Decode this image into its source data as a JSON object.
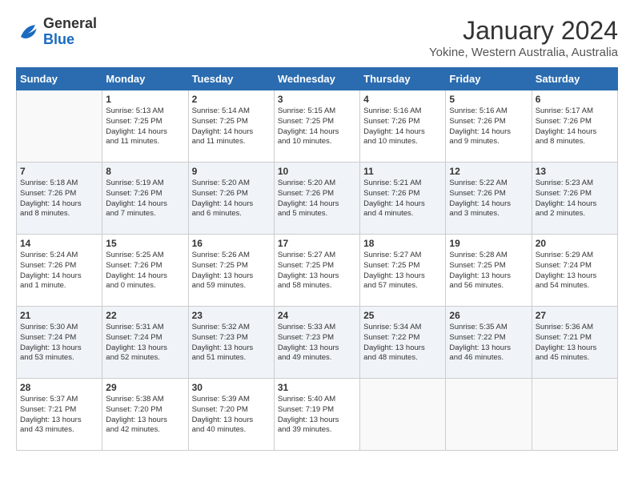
{
  "logo": {
    "general": "General",
    "blue": "Blue"
  },
  "title": "January 2024",
  "subtitle": "Yokine, Western Australia, Australia",
  "headers": [
    "Sunday",
    "Monday",
    "Tuesday",
    "Wednesday",
    "Thursday",
    "Friday",
    "Saturday"
  ],
  "weeks": [
    [
      {
        "date": "",
        "info": ""
      },
      {
        "date": "1",
        "info": "Sunrise: 5:13 AM\nSunset: 7:25 PM\nDaylight: 14 hours\nand 11 minutes."
      },
      {
        "date": "2",
        "info": "Sunrise: 5:14 AM\nSunset: 7:25 PM\nDaylight: 14 hours\nand 11 minutes."
      },
      {
        "date": "3",
        "info": "Sunrise: 5:15 AM\nSunset: 7:25 PM\nDaylight: 14 hours\nand 10 minutes."
      },
      {
        "date": "4",
        "info": "Sunrise: 5:16 AM\nSunset: 7:26 PM\nDaylight: 14 hours\nand 10 minutes."
      },
      {
        "date": "5",
        "info": "Sunrise: 5:16 AM\nSunset: 7:26 PM\nDaylight: 14 hours\nand 9 minutes."
      },
      {
        "date": "6",
        "info": "Sunrise: 5:17 AM\nSunset: 7:26 PM\nDaylight: 14 hours\nand 8 minutes."
      }
    ],
    [
      {
        "date": "7",
        "info": "Sunrise: 5:18 AM\nSunset: 7:26 PM\nDaylight: 14 hours\nand 8 minutes."
      },
      {
        "date": "8",
        "info": "Sunrise: 5:19 AM\nSunset: 7:26 PM\nDaylight: 14 hours\nand 7 minutes."
      },
      {
        "date": "9",
        "info": "Sunrise: 5:20 AM\nSunset: 7:26 PM\nDaylight: 14 hours\nand 6 minutes."
      },
      {
        "date": "10",
        "info": "Sunrise: 5:20 AM\nSunset: 7:26 PM\nDaylight: 14 hours\nand 5 minutes."
      },
      {
        "date": "11",
        "info": "Sunrise: 5:21 AM\nSunset: 7:26 PM\nDaylight: 14 hours\nand 4 minutes."
      },
      {
        "date": "12",
        "info": "Sunrise: 5:22 AM\nSunset: 7:26 PM\nDaylight: 14 hours\nand 3 minutes."
      },
      {
        "date": "13",
        "info": "Sunrise: 5:23 AM\nSunset: 7:26 PM\nDaylight: 14 hours\nand 2 minutes."
      }
    ],
    [
      {
        "date": "14",
        "info": "Sunrise: 5:24 AM\nSunset: 7:26 PM\nDaylight: 14 hours\nand 1 minute."
      },
      {
        "date": "15",
        "info": "Sunrise: 5:25 AM\nSunset: 7:26 PM\nDaylight: 14 hours\nand 0 minutes."
      },
      {
        "date": "16",
        "info": "Sunrise: 5:26 AM\nSunset: 7:25 PM\nDaylight: 13 hours\nand 59 minutes."
      },
      {
        "date": "17",
        "info": "Sunrise: 5:27 AM\nSunset: 7:25 PM\nDaylight: 13 hours\nand 58 minutes."
      },
      {
        "date": "18",
        "info": "Sunrise: 5:27 AM\nSunset: 7:25 PM\nDaylight: 13 hours\nand 57 minutes."
      },
      {
        "date": "19",
        "info": "Sunrise: 5:28 AM\nSunset: 7:25 PM\nDaylight: 13 hours\nand 56 minutes."
      },
      {
        "date": "20",
        "info": "Sunrise: 5:29 AM\nSunset: 7:24 PM\nDaylight: 13 hours\nand 54 minutes."
      }
    ],
    [
      {
        "date": "21",
        "info": "Sunrise: 5:30 AM\nSunset: 7:24 PM\nDaylight: 13 hours\nand 53 minutes."
      },
      {
        "date": "22",
        "info": "Sunrise: 5:31 AM\nSunset: 7:24 PM\nDaylight: 13 hours\nand 52 minutes."
      },
      {
        "date": "23",
        "info": "Sunrise: 5:32 AM\nSunset: 7:23 PM\nDaylight: 13 hours\nand 51 minutes."
      },
      {
        "date": "24",
        "info": "Sunrise: 5:33 AM\nSunset: 7:23 PM\nDaylight: 13 hours\nand 49 minutes."
      },
      {
        "date": "25",
        "info": "Sunrise: 5:34 AM\nSunset: 7:22 PM\nDaylight: 13 hours\nand 48 minutes."
      },
      {
        "date": "26",
        "info": "Sunrise: 5:35 AM\nSunset: 7:22 PM\nDaylight: 13 hours\nand 46 minutes."
      },
      {
        "date": "27",
        "info": "Sunrise: 5:36 AM\nSunset: 7:21 PM\nDaylight: 13 hours\nand 45 minutes."
      }
    ],
    [
      {
        "date": "28",
        "info": "Sunrise: 5:37 AM\nSunset: 7:21 PM\nDaylight: 13 hours\nand 43 minutes."
      },
      {
        "date": "29",
        "info": "Sunrise: 5:38 AM\nSunset: 7:20 PM\nDaylight: 13 hours\nand 42 minutes."
      },
      {
        "date": "30",
        "info": "Sunrise: 5:39 AM\nSunset: 7:20 PM\nDaylight: 13 hours\nand 40 minutes."
      },
      {
        "date": "31",
        "info": "Sunrise: 5:40 AM\nSunset: 7:19 PM\nDaylight: 13 hours\nand 39 minutes."
      },
      {
        "date": "",
        "info": ""
      },
      {
        "date": "",
        "info": ""
      },
      {
        "date": "",
        "info": ""
      }
    ]
  ]
}
